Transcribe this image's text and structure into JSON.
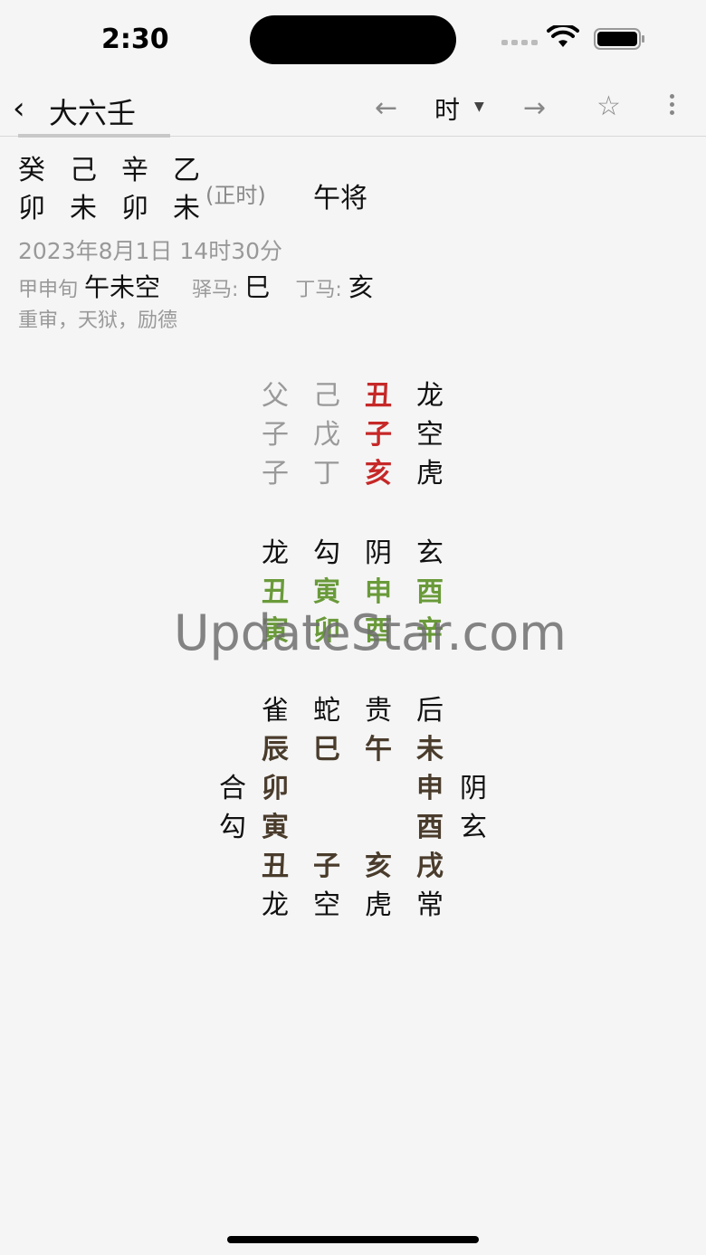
{
  "status": {
    "time": "2:30"
  },
  "nav": {
    "title": "大六壬",
    "unit": "时",
    "back_icon": "chevron-left-icon",
    "prev_icon": "arrow-left-icon",
    "next_icon": "arrow-right-icon",
    "star_icon": "star-icon",
    "more_icon": "more-vertical-icon"
  },
  "header": {
    "stems": [
      "癸",
      "己",
      "辛",
      "乙"
    ],
    "branches": [
      "卯",
      "未",
      "卯",
      "未"
    ],
    "zhengshi": "(正时)",
    "wujiang": "午将",
    "date": "2023年8月1日 14时30分",
    "xun_label": "甲申旬",
    "xun_value": "午未空",
    "yima_label": "驿马:",
    "yima_value": "巳",
    "dingma_label": "丁马:",
    "dingma_value": "亥",
    "tags": "重审，天狱，励德"
  },
  "sanchuan": [
    [
      "父",
      "己",
      "丑",
      "龙"
    ],
    [
      "子",
      "戊",
      "子",
      "空"
    ],
    [
      "子",
      "丁",
      "亥",
      "虎"
    ]
  ],
  "sike": {
    "gods": [
      "龙",
      "勾",
      "阴",
      "玄"
    ],
    "upper": [
      "丑",
      "寅",
      "申",
      "酉"
    ],
    "lower": [
      "寅",
      "卯",
      "酉",
      "辛"
    ]
  },
  "tianpan": {
    "top_gods": [
      "雀",
      "蛇",
      "贵",
      "后"
    ],
    "top": [
      "辰",
      "巳",
      "午",
      "未"
    ],
    "left_gods": [
      "合",
      "勾"
    ],
    "left": [
      "卯",
      "寅"
    ],
    "right": [
      "申",
      "酉"
    ],
    "right_gods": [
      "阴",
      "玄"
    ],
    "bottom": [
      "丑",
      "子",
      "亥",
      "戌"
    ],
    "bottom_gods": [
      "龙",
      "空",
      "虎",
      "常"
    ]
  },
  "watermark": "UpdateStar.com",
  "colors": {
    "red": "#c62828",
    "green": "#6a9a3a",
    "gray": "#999999",
    "brown": "#4a3c2c"
  }
}
